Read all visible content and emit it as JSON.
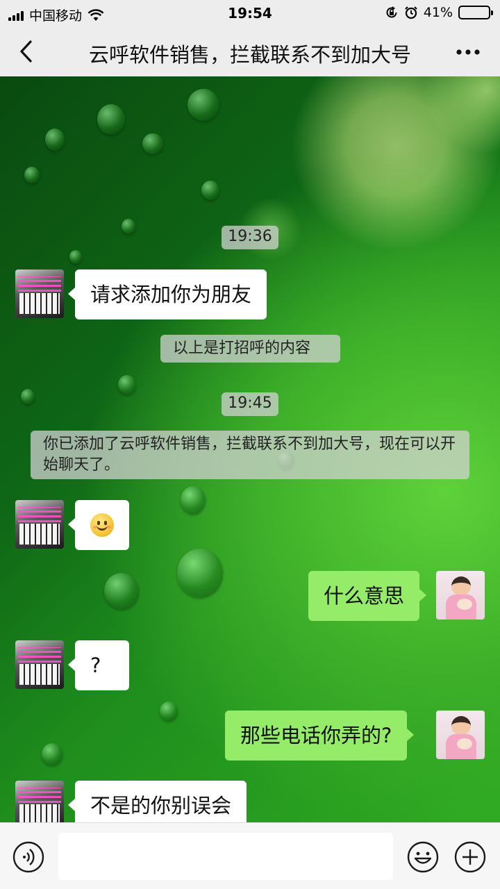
{
  "status_bar": {
    "carrier": "中国移动",
    "time": "19:54",
    "battery": "41%",
    "battery_level": 0.41
  },
  "header": {
    "back_icon": "chevron-left-icon",
    "title": "云呼软件销售，拦截联系不到加大号",
    "more_icon": "more-dots-icon"
  },
  "chat": {
    "timestamps": [
      "19:36",
      "19:45"
    ],
    "system_notes": [
      "以上是打招呼的内容",
      "你已添加了云呼软件销售，拦截联系不到加大号，现在可以开始聊天了。"
    ],
    "messages": [
      {
        "from": "contact",
        "text": "请求添加你为朋友"
      },
      {
        "from": "contact",
        "emoji": "smiley-emoji"
      },
      {
        "from": "me",
        "text": "什么意思"
      },
      {
        "from": "contact",
        "text": "?"
      },
      {
        "from": "me",
        "text": "那些电话你弄的?"
      },
      {
        "from": "contact",
        "text": "不是的你别误会"
      }
    ]
  },
  "input_bar": {
    "voice_icon": "voice-icon",
    "emoji_icon": "emoji-icon",
    "plus_icon": "plus-icon",
    "placeholder": ""
  },
  "colors": {
    "bar_bg": "#ededed",
    "my_bubble": "#95ec69",
    "their_bubble": "#ffffff",
    "wallpaper": "#1f8e1d"
  }
}
